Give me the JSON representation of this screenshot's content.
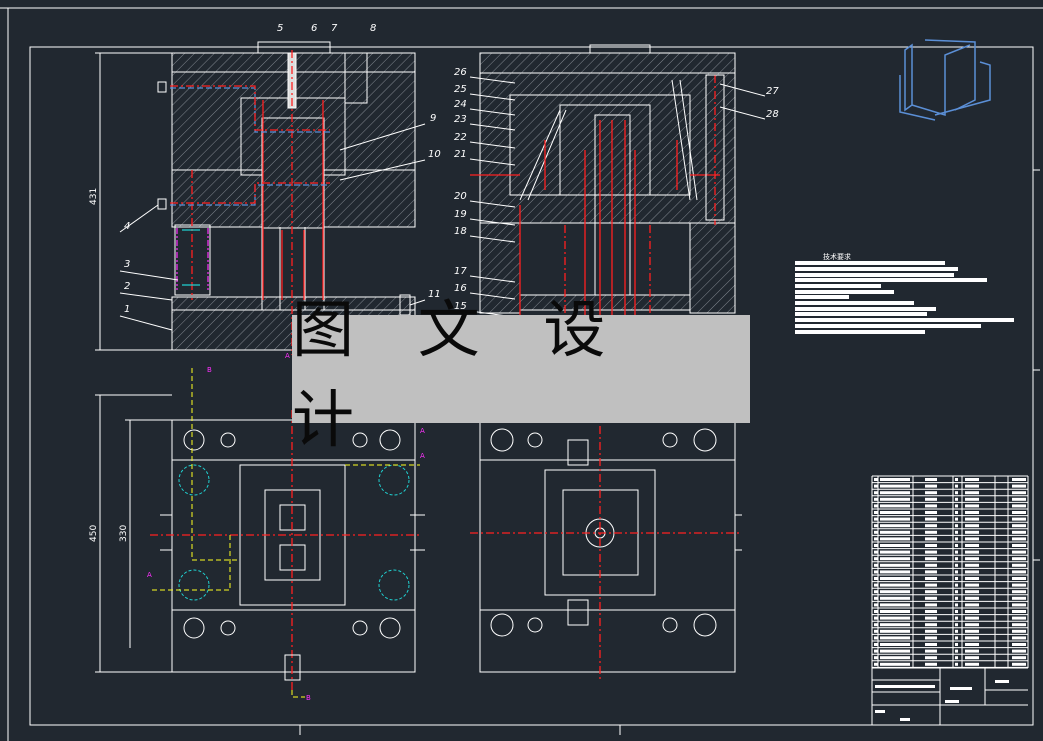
{
  "drawing": {
    "watermark_text": "图 文 设 计",
    "tech_requirements_title": "技术要求",
    "dimensions": {
      "height_section": "431",
      "plan_total": "450",
      "plan_inner": "330"
    },
    "part_labels_left": [
      "1",
      "2",
      "3",
      "4",
      "5",
      "6",
      "7",
      "8",
      "9",
      "10",
      "11"
    ],
    "part_labels_right": [
      "15",
      "16",
      "17",
      "18",
      "19",
      "20",
      "21",
      "22",
      "23",
      "24",
      "25",
      "26",
      "27",
      "28"
    ],
    "section_markers": [
      "A",
      "A",
      "A",
      "A",
      "B",
      "B"
    ],
    "colors": {
      "background": "#212830",
      "lines": "#ffffff",
      "centerlines": "#ff2020",
      "cooling": "#5b8fd6",
      "springs": "#ff30ff",
      "section_path": "#ffff20",
      "watermark_bg": "#c0c0c0"
    }
  }
}
